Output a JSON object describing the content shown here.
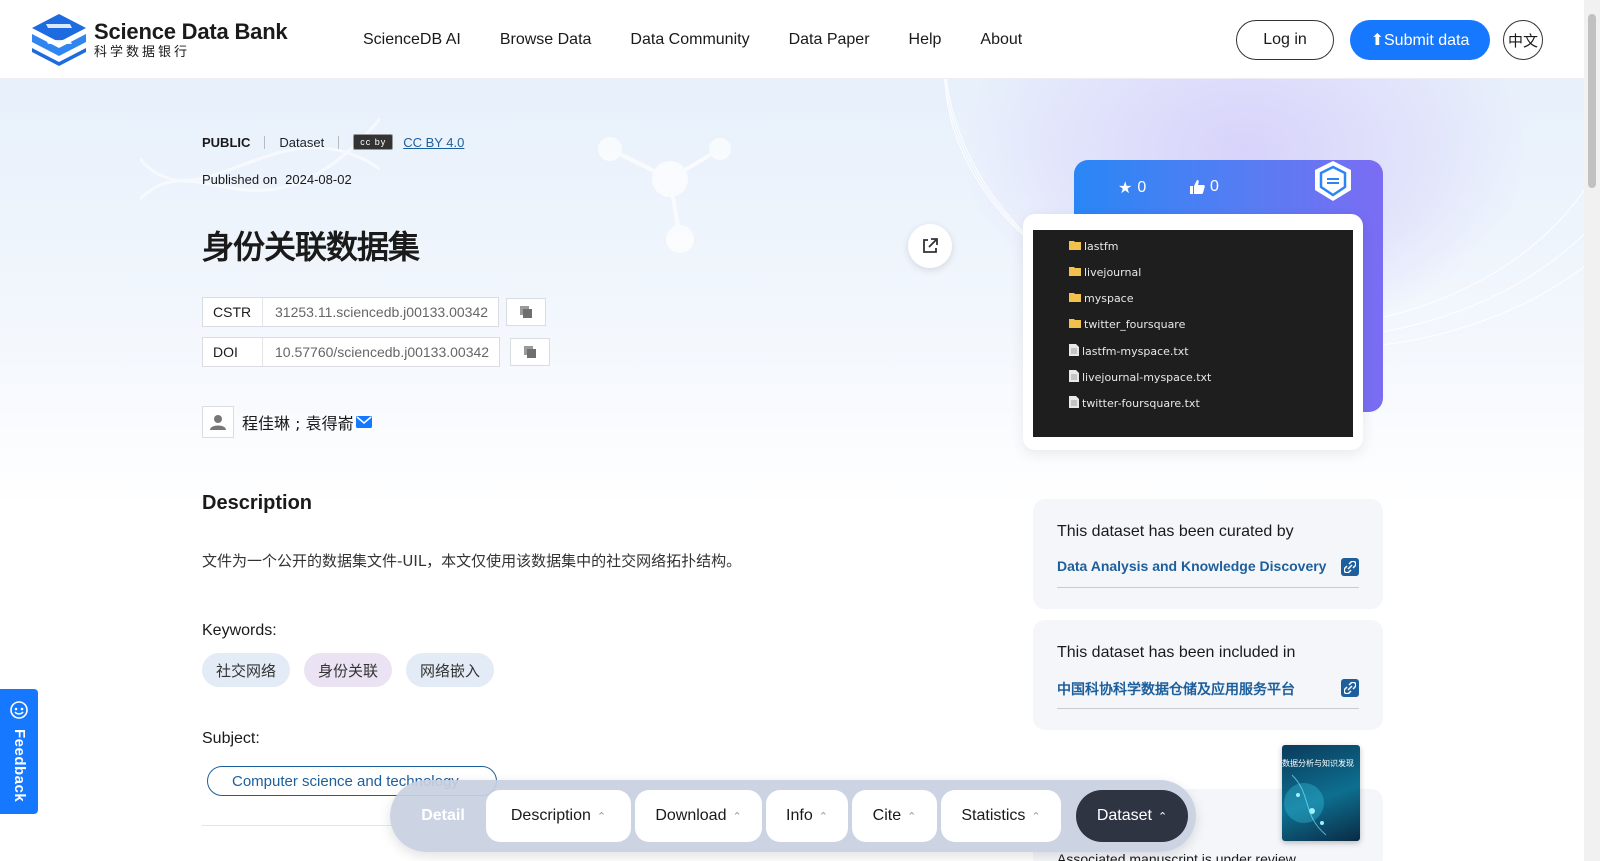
{
  "header": {
    "logo_en": "Science Data Bank",
    "logo_cn": "科学数据银行",
    "nav": [
      "ScienceDB AI",
      "Browse Data",
      "Data Community",
      "Data Paper",
      "Help",
      "About"
    ],
    "login_label": "Log in",
    "submit_label": "Submit data",
    "lang_label": "中文"
  },
  "dataset": {
    "visibility": "PUBLIC",
    "type": "Dataset",
    "license_badge": "cc by",
    "license": "CC BY 4.0",
    "published_label": "Published on",
    "published_date": "2024-08-02",
    "title": "身份关联数据集",
    "cstr_label": "CSTR",
    "cstr": "31253.11.sciencedb.j00133.00342",
    "doi_label": "DOI",
    "doi": "10.57760/sciencedb.j00133.00342",
    "authors": "程佳琳 ; 袁得嵛"
  },
  "description": {
    "title": "Description",
    "text": "文件为一个公开的数据集文件-UIL，本文仅使用该数据集中的社交网络拓扑结构。"
  },
  "keywords": {
    "label": "Keywords:",
    "items": [
      "社交网络",
      "身份关联",
      "网络嵌入"
    ],
    "colors": [
      "#e3ebf6",
      "#ebe3f3",
      "#e3ebf6"
    ]
  },
  "subject": {
    "label": "Subject:",
    "value": "Computer science and technology"
  },
  "stats": {
    "stars": "0",
    "likes": "0"
  },
  "preview_files": [
    {
      "name": "lastfm",
      "kind": "folder"
    },
    {
      "name": "livejournal",
      "kind": "folder"
    },
    {
      "name": "myspace",
      "kind": "folder"
    },
    {
      "name": "twitter_foursquare",
      "kind": "folder"
    },
    {
      "name": "lastfm-myspace.txt",
      "kind": "file"
    },
    {
      "name": "livejournal-myspace.txt",
      "kind": "file"
    },
    {
      "name": "twitter-foursquare.txt",
      "kind": "file"
    }
  ],
  "curated": {
    "heading": "This dataset has been curated by",
    "link": "Data Analysis and Knowledge Discovery"
  },
  "included": {
    "heading": "This dataset has been included in",
    "link": "中国科协科学数据仓储及应用服务平台"
  },
  "manuscript": {
    "status": "Associated manuscript is under review",
    "journal_cover_title": "数据分析与知识发现"
  },
  "feedback_label": "Feedback",
  "tabbar": {
    "detail": "Detail",
    "tabs": [
      "Description",
      "Download",
      "Info",
      "Cite",
      "Statistics",
      "Dataset"
    ]
  },
  "colors": {
    "brand": "#1677ff",
    "link": "#1d5f9c",
    "tab_active": "#2f3442"
  }
}
